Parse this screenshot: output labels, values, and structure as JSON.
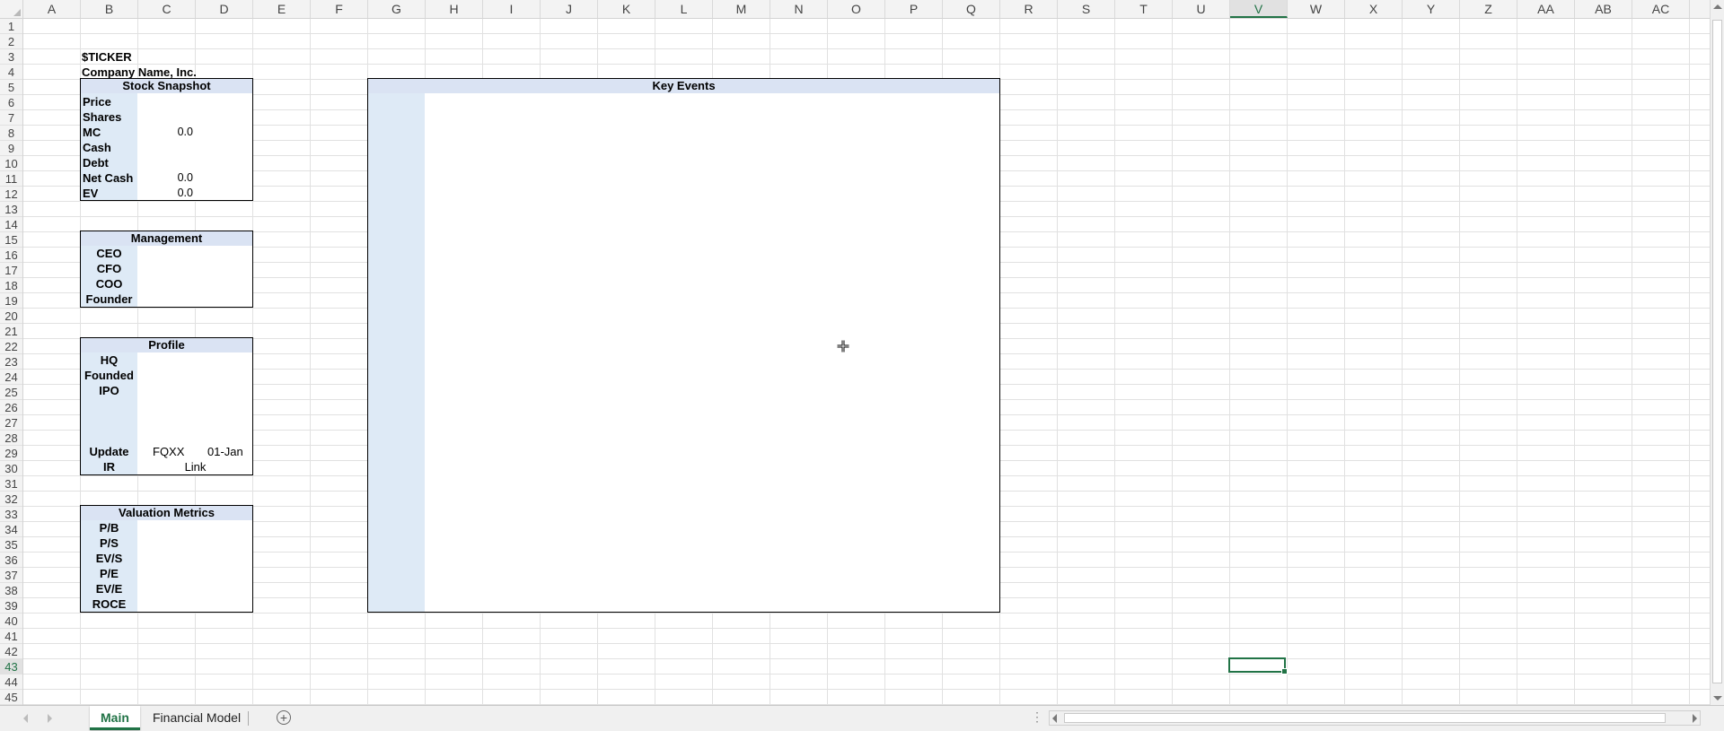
{
  "columns": [
    "A",
    "B",
    "C",
    "D",
    "E",
    "F",
    "G",
    "H",
    "I",
    "J",
    "K",
    "L",
    "M",
    "N",
    "O",
    "P",
    "Q",
    "R",
    "S",
    "T",
    "U",
    "V",
    "W",
    "X",
    "Y",
    "Z",
    "AA",
    "AB",
    "AC"
  ],
  "selected_column": "V",
  "row_count": 45,
  "selected_row": "43",
  "header_cells": {
    "ticker": "$TICKER",
    "company": "Company Name, Inc."
  },
  "stock_snapshot": {
    "title": "Stock Snapshot",
    "rows": [
      {
        "label": "Price",
        "value": ""
      },
      {
        "label": "Shares",
        "value": ""
      },
      {
        "label": "MC",
        "value": "0.0"
      },
      {
        "label": "Cash",
        "value": ""
      },
      {
        "label": "Debt",
        "value": ""
      },
      {
        "label": "Net Cash",
        "value": "0.0"
      },
      {
        "label": "EV",
        "value": "0.0"
      }
    ]
  },
  "management": {
    "title": "Management",
    "rows": [
      {
        "label": "CEO"
      },
      {
        "label": "CFO"
      },
      {
        "label": "COO"
      },
      {
        "label": "Founder"
      }
    ]
  },
  "profile": {
    "title": "Profile",
    "rows": [
      {
        "label": "HQ"
      },
      {
        "label": "Founded"
      },
      {
        "label": "IPO"
      }
    ],
    "update_label": "Update",
    "update_quarter": "FQXX",
    "update_date": "01-Jan",
    "ir_label": "IR",
    "ir_link": "Link"
  },
  "valuation": {
    "title": "Valuation Metrics",
    "rows": [
      {
        "label": "P/B"
      },
      {
        "label": "P/S"
      },
      {
        "label": "EV/S"
      },
      {
        "label": "P/E"
      },
      {
        "label": "EV/E"
      },
      {
        "label": "ROCE"
      }
    ]
  },
  "key_events": {
    "title": "Key Events"
  },
  "sheet_tabs": [
    {
      "label": "Main",
      "active": true
    },
    {
      "label": "Financial Model",
      "active": false
    }
  ],
  "icons": {
    "add_sheet": "+",
    "more": "⋮",
    "cursor": "move-cursor-icon"
  },
  "colors": {
    "accent": "#217346",
    "table_header": "#dae3f3",
    "label_column": "#deeaf6"
  }
}
